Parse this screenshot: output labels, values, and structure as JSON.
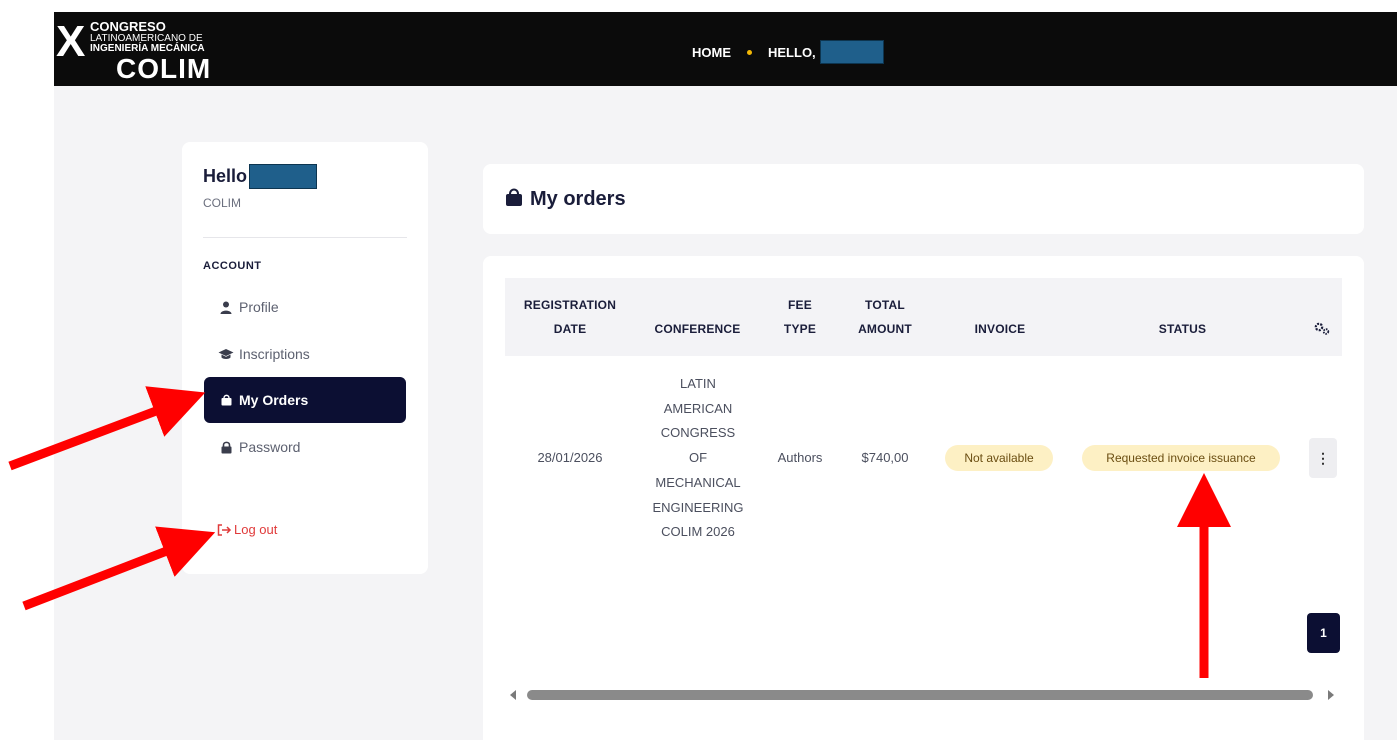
{
  "logo": {
    "roman": "X",
    "line1": "CONGRESO",
    "line2": "LATINOAMERICANO DE",
    "line3": "INGENIERÍA MECÁNICA",
    "line4": "COLIM"
  },
  "topnav": {
    "home": "HOME",
    "hello": "HELLO,"
  },
  "sidebar": {
    "hello": "Hello",
    "org": "COLIM",
    "section": "ACCOUNT",
    "items": [
      {
        "label": "Profile",
        "icon": "user-icon"
      },
      {
        "label": "Inscriptions",
        "icon": "graduation-cap-icon"
      },
      {
        "label": "My Orders",
        "icon": "shopping-bag-icon",
        "active": true
      },
      {
        "label": "Password",
        "icon": "lock-icon"
      }
    ],
    "logout": "Log out"
  },
  "header": {
    "title": "My orders",
    "icon": "shopping-bag-icon"
  },
  "table": {
    "columns": [
      {
        "line1": "REGISTRATION",
        "line2": "DATE"
      },
      {
        "line1": "",
        "line2": "CONFERENCE"
      },
      {
        "line1": "FEE",
        "line2": "TYPE"
      },
      {
        "line1": "TOTAL",
        "line2": "AMOUNT"
      },
      {
        "line1": "",
        "line2": "INVOICE"
      },
      {
        "line1": "",
        "line2": "STATUS"
      }
    ],
    "settings_icon": "gears-icon",
    "rows": [
      {
        "date": "28/01/2026",
        "conference_lines": [
          "LATIN",
          "AMERICAN",
          "CONGRESS",
          "OF",
          "MECHANICAL",
          "ENGINEERING",
          "COLIM 2026"
        ],
        "fee_type": "Authors",
        "total": "$740,00",
        "invoice": "Not available",
        "status": "Requested invoice issuance"
      }
    ],
    "page": "1"
  },
  "colors": {
    "accent_dark": "#0c0f33",
    "badge_bg": "#fdf0c4",
    "logout": "#e03a3a",
    "annotation_arrow": "#ff0000"
  }
}
